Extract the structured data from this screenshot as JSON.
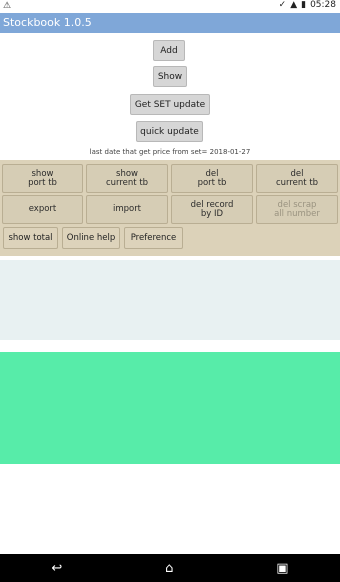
{
  "status_bar": {
    "time": "05:28",
    "battery_icon": "battery-icon",
    "signal_icon": "signal-icon"
  },
  "app": {
    "title": "Stockbook 1.0.5"
  },
  "buttons": {
    "add": "Add",
    "show": "Show",
    "get_set_update": "Get SET update",
    "quick_update": "quick update"
  },
  "info_text": "last date that get price from set= 2018-01-27",
  "grid": [
    {
      "line1": "show",
      "line2": "port tb"
    },
    {
      "line1": "show",
      "line2": "current tb"
    },
    {
      "line1": "del",
      "line2": "port tb"
    },
    {
      "line1": "del",
      "line2": "current tb"
    },
    {
      "line1": "export",
      "line2": ""
    },
    {
      "line1": "import",
      "line2": ""
    },
    {
      "line1": "del record",
      "line2": "by ID"
    },
    {
      "line1": "del scrap",
      "line2": "all number"
    }
  ],
  "small_buttons": {
    "show_total": "show total",
    "online_help": "Online help",
    "preference": "Preference"
  },
  "nav": {
    "back": "↩",
    "home": "⌂",
    "recent": "▣"
  },
  "colors": {
    "title_bar": "#7fa7d8",
    "panel": "#dcd2b9",
    "green_area": "#57eca9"
  }
}
